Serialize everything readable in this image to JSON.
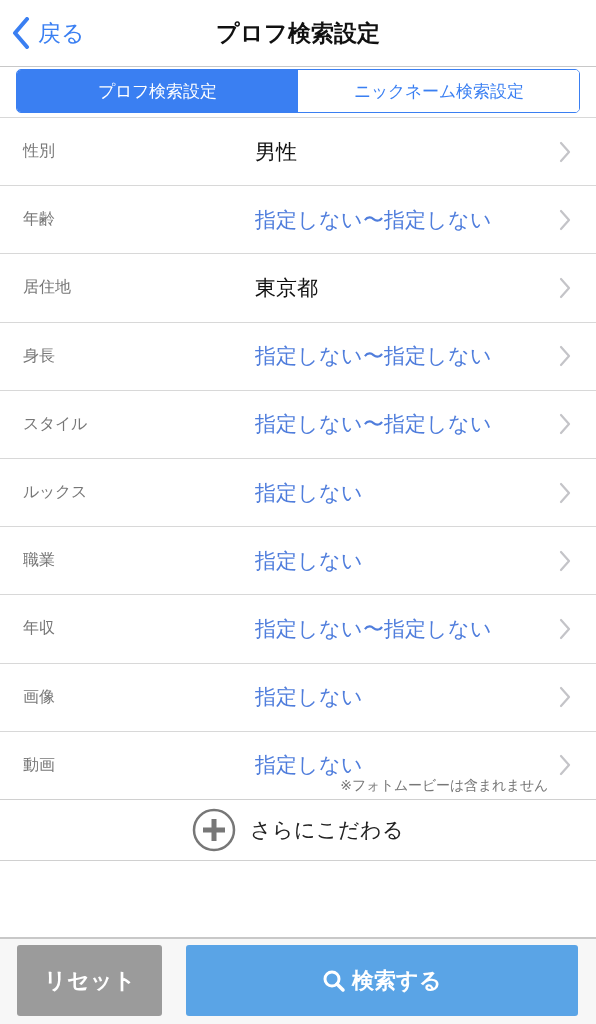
{
  "nav": {
    "back": "戻る",
    "title": "プロフ検索設定"
  },
  "tabs": [
    {
      "label": "プロフ検索設定",
      "selected": true
    },
    {
      "label": "ニックネーム検索設定",
      "selected": false
    }
  ],
  "rows": [
    {
      "label": "性別",
      "value": "男性",
      "specified": true
    },
    {
      "label": "年齢",
      "value": "指定しない〜指定しない",
      "specified": false
    },
    {
      "label": "居住地",
      "value": "東京都",
      "specified": true
    },
    {
      "label": "身長",
      "value": "指定しない〜指定しない",
      "specified": false
    },
    {
      "label": "スタイル",
      "value": "指定しない〜指定しない",
      "specified": false
    },
    {
      "label": "ルックス",
      "value": "指定しない",
      "specified": false
    },
    {
      "label": "職業",
      "value": "指定しない",
      "specified": false
    },
    {
      "label": "年収",
      "value": "指定しない〜指定しない",
      "specified": false
    },
    {
      "label": "画像",
      "value": "指定しない",
      "specified": false
    },
    {
      "label": "動画",
      "value": "指定しない",
      "specified": false,
      "note": "※フォトムービーは含まれません"
    }
  ],
  "more": "さらにこだわる",
  "footer": {
    "reset": "リセット",
    "search": "検索する"
  }
}
